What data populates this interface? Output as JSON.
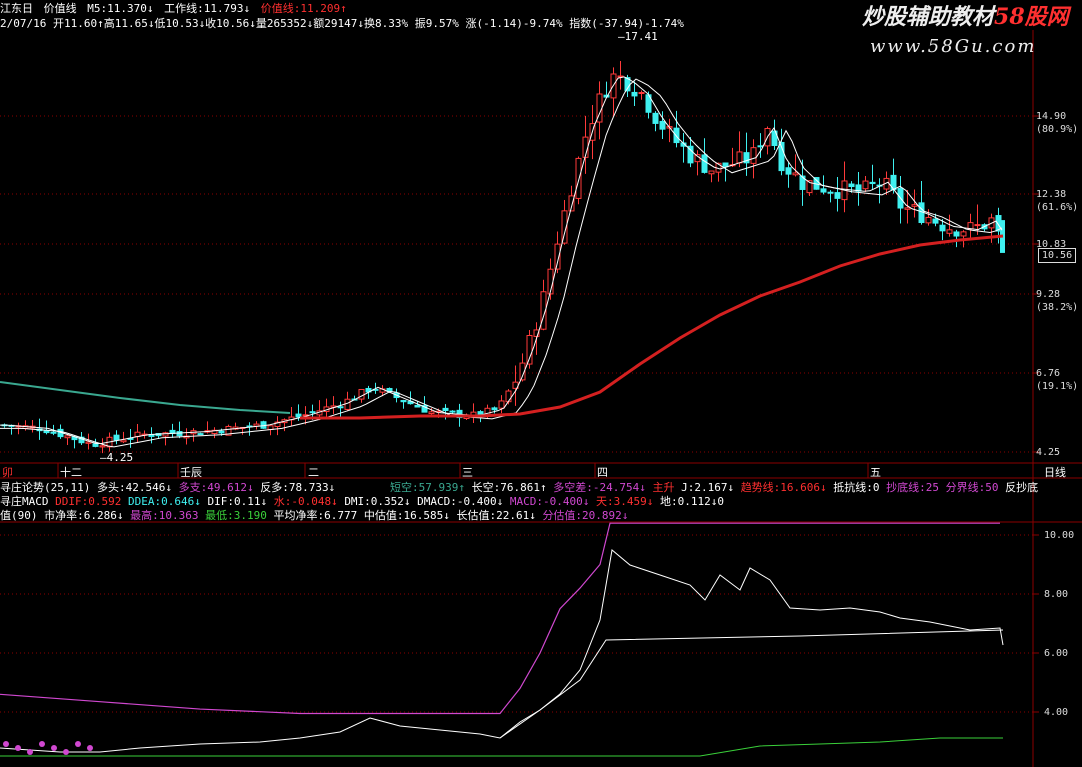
{
  "header": {
    "row1": {
      "stock": "江东日",
      "indicator": "价值线",
      "m5": "M5:11.370↓",
      "work": "工作线:11.793↓",
      "price_line": "价值线:11.209↑"
    },
    "row2": "2/07/16  开11.60↑高11.65↓低10.53↓收10.56↓量265352↓额29147↓换8.33%  振9.57%  涨(-1.14)-9.74%  指数(-37.94)-1.74%"
  },
  "watermark": {
    "title_a": "炒股辅助教材",
    "title_b": "58股网",
    "url": "www.58Gu.com"
  },
  "price_axis": {
    "labels": [
      {
        "v": "14.90",
        "pct": "(80.9%)"
      },
      {
        "v": "12.38",
        "pct": "(61.6%)"
      },
      {
        "v": "10.83",
        "pct": ""
      },
      {
        "v": "9.28",
        "pct": "(38.2%)"
      },
      {
        "v": "6.76",
        "pct": "(19.1%)"
      },
      {
        "v": "4.25",
        "pct": ""
      }
    ],
    "current": "10.56",
    "high_mark": "17.41",
    "low_mark": "4.25"
  },
  "time_axis": [
    "卯",
    "十二",
    "壬辰",
    "二",
    "三",
    "四",
    "五"
  ],
  "time_axis_right": "日线",
  "ind_row1": {
    "a": "寻庄论势(25,11)",
    "b": "多头:42.546↓",
    "c": "多支:49.612↓",
    "d": "反多:78.733↓",
    "e": "短空:57.939↑",
    "f": "长空:76.861↑",
    "g": "多空差:-24.754↓",
    "h": "主升",
    "i": "J:2.167↓",
    "j": "趋势线:16.606↓",
    "k": "抵抗线:0",
    "l": "抄底线:25",
    "m": "分界线:50",
    "n": "反抄底"
  },
  "ind_row2": {
    "a": "寻庄MACD",
    "b": "DDIF:0.592",
    "c": "DDEA:0.646↓",
    "d": "DIF:0.11↓",
    "e": "水:-0.048↓",
    "f": "DMI:0.352↓",
    "g": "DMACD:-0.400↓",
    "h": "MACD:-0.400↓",
    "i": "天:3.459↓",
    "j": "地:0.112↓0"
  },
  "ind_row3": {
    "a": "值(90)",
    "b": "市净率:6.286↓",
    "c": "最高:10.363",
    "d": "最低:3.190",
    "e": "平均净率:6.777",
    "f": "中估值:16.585↓",
    "g": "长估值:22.61↓",
    "h": "分估值:20.892↓"
  },
  "lower_axis": [
    "10.00",
    "8.00",
    "6.00",
    "4.00"
  ],
  "colors": {
    "up": "#ff3a3a",
    "down": "#3ff0f0",
    "ma_red": "#d42020",
    "teal": "#3aa890",
    "magenta": "#d048d0",
    "grid": "#8b0000",
    "green": "#3ad03a",
    "yellow": "#f0f040"
  }
}
